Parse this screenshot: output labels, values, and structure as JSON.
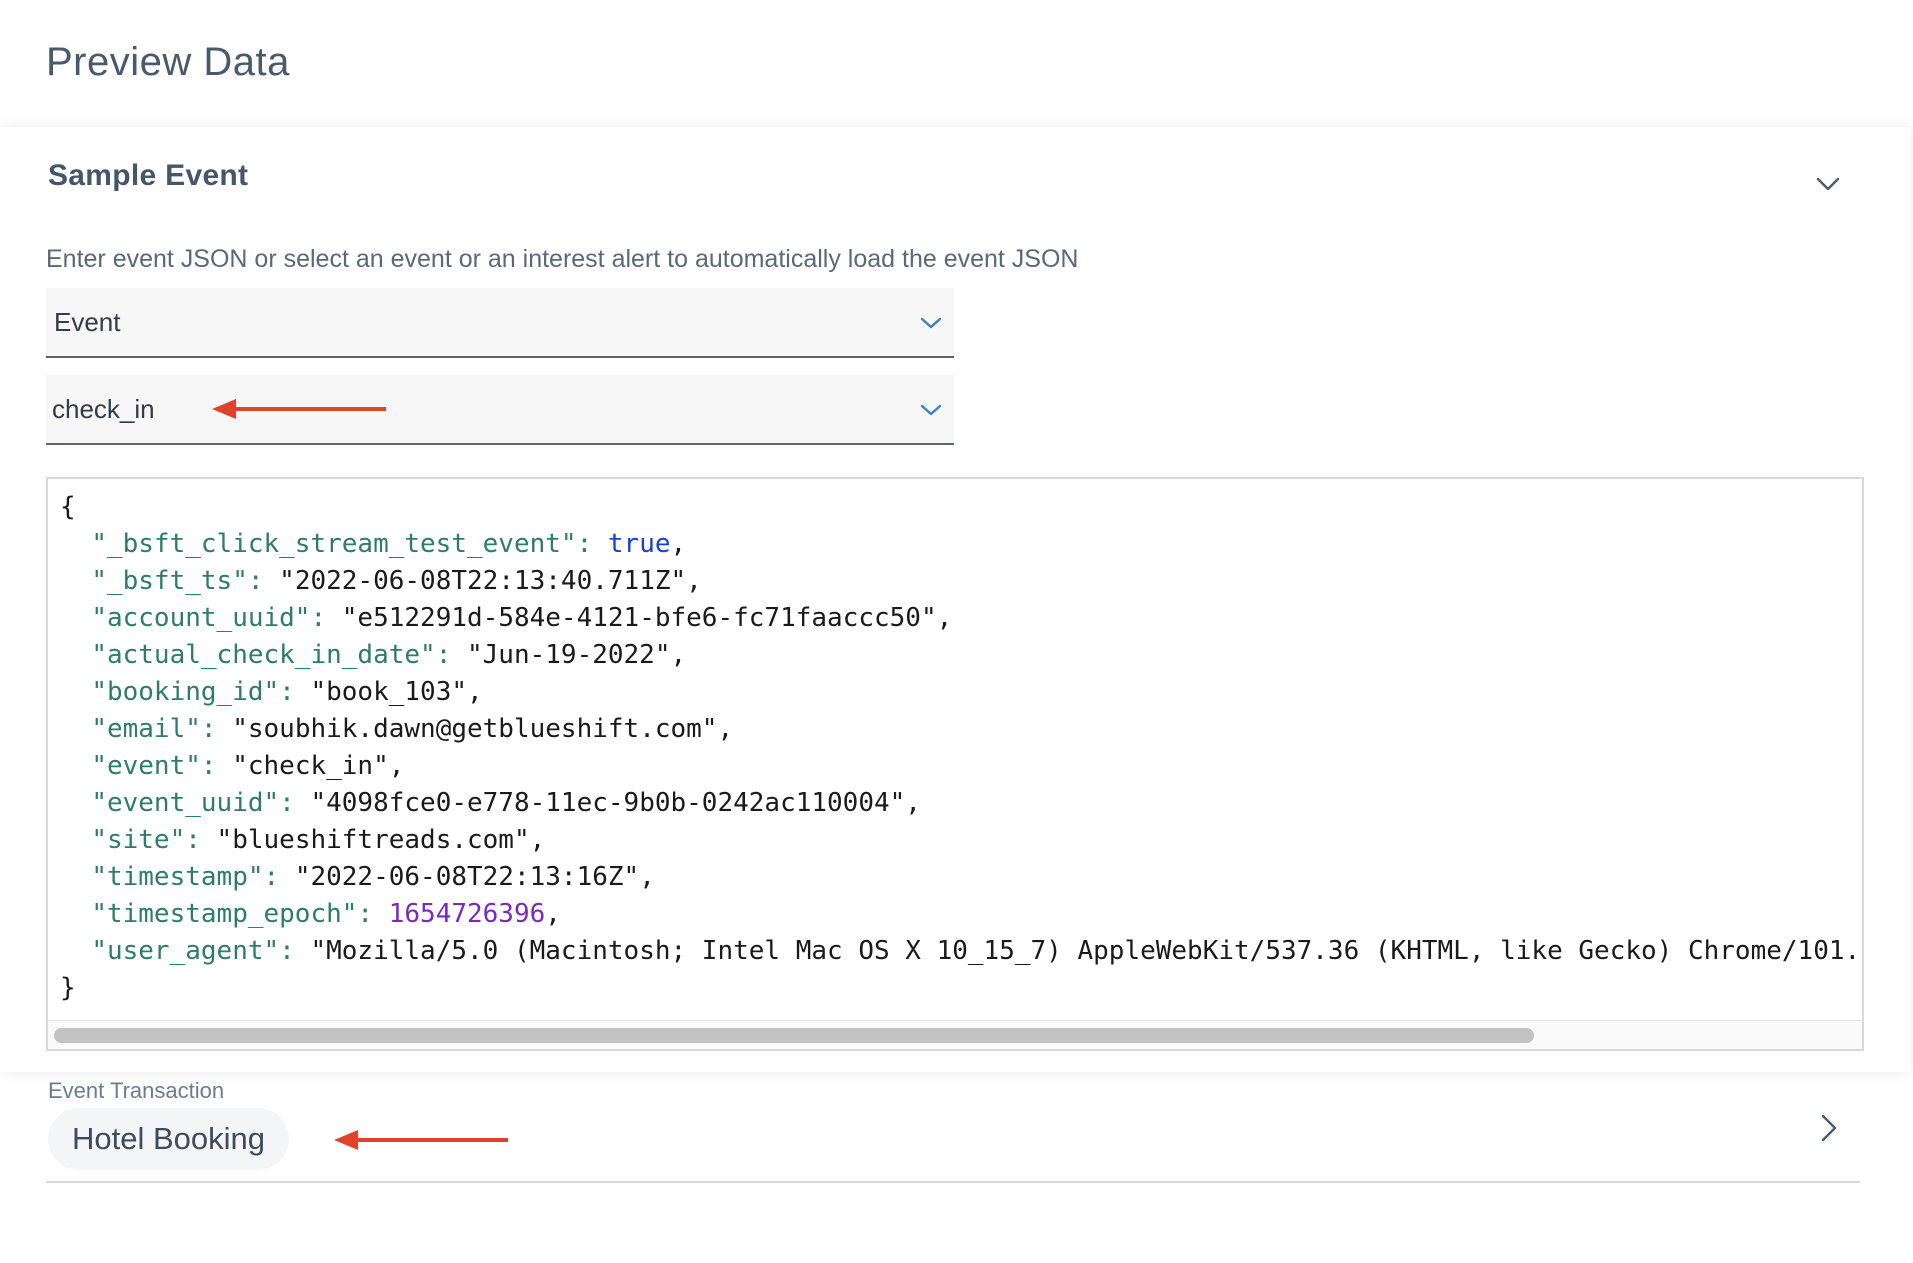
{
  "page": {
    "title": "Preview Data"
  },
  "sample_event": {
    "title": "Sample Event",
    "instructions": "Enter event JSON or select an event or an interest alert to automatically load the event JSON",
    "type_select": {
      "value": "Event"
    },
    "event_select": {
      "value": "check_in"
    },
    "json_lines": [
      {
        "text": "{"
      },
      {
        "key": "\"_bsft_click_stream_test_event\"",
        "sep": ": ",
        "value": "true",
        "vtype": "bool",
        "end": ","
      },
      {
        "key": "\"_bsft_ts\"",
        "sep": ": ",
        "value": "\"2022-06-08T22:13:40.711Z\"",
        "vtype": "string",
        "end": ","
      },
      {
        "key": "\"account_uuid\"",
        "sep": ": ",
        "value": "\"e512291d-584e-4121-bfe6-fc71faaccc50\"",
        "vtype": "string",
        "end": ","
      },
      {
        "key": "\"actual_check_in_date\"",
        "sep": ": ",
        "value": "\"Jun-19-2022\"",
        "vtype": "string",
        "end": ","
      },
      {
        "key": "\"booking_id\"",
        "sep": ": ",
        "value": "\"book_103\"",
        "vtype": "string",
        "end": ","
      },
      {
        "key": "\"email\"",
        "sep": ": ",
        "value": "\"soubhik.dawn@getblueshift.com\"",
        "vtype": "string",
        "end": ","
      },
      {
        "key": "\"event\"",
        "sep": ": ",
        "value": "\"check_in\"",
        "vtype": "string",
        "end": ","
      },
      {
        "key": "\"event_uuid\"",
        "sep": ": ",
        "value": "\"4098fce0-e778-11ec-9b0b-0242ac110004\"",
        "vtype": "string",
        "end": ","
      },
      {
        "key": "\"site\"",
        "sep": ": ",
        "value": "\"blueshiftreads.com\"",
        "vtype": "string",
        "end": ","
      },
      {
        "key": "\"timestamp\"",
        "sep": ": ",
        "value": "\"2022-06-08T22:13:16Z\"",
        "vtype": "string",
        "end": ","
      },
      {
        "key": "\"timestamp_epoch\"",
        "sep": ": ",
        "value": "1654726396",
        "vtype": "number",
        "end": ","
      },
      {
        "key": "\"user_agent\"",
        "sep": ": ",
        "value": "\"Mozilla/5.0 (Macintosh; Intel Mac OS X 10_15_7) AppleWebKit/537.36 (KHTML, like Gecko) Chrome/101.",
        "vtype": "string",
        "end": ""
      },
      {
        "text": "}"
      }
    ]
  },
  "event_transaction": {
    "label": "Event Transaction",
    "value": "Hotel Booking"
  },
  "colors": {
    "annotation_arrow": "#e2412b",
    "json_key": "#2e7d66",
    "json_bool": "#1a3fd6",
    "json_number": "#7b2ab8"
  },
  "icons": {
    "collapse": "chevron-down-icon",
    "select": "chevron-down-icon",
    "transaction": "chevron-right-icon",
    "annotation": "arrow-left-icon"
  }
}
